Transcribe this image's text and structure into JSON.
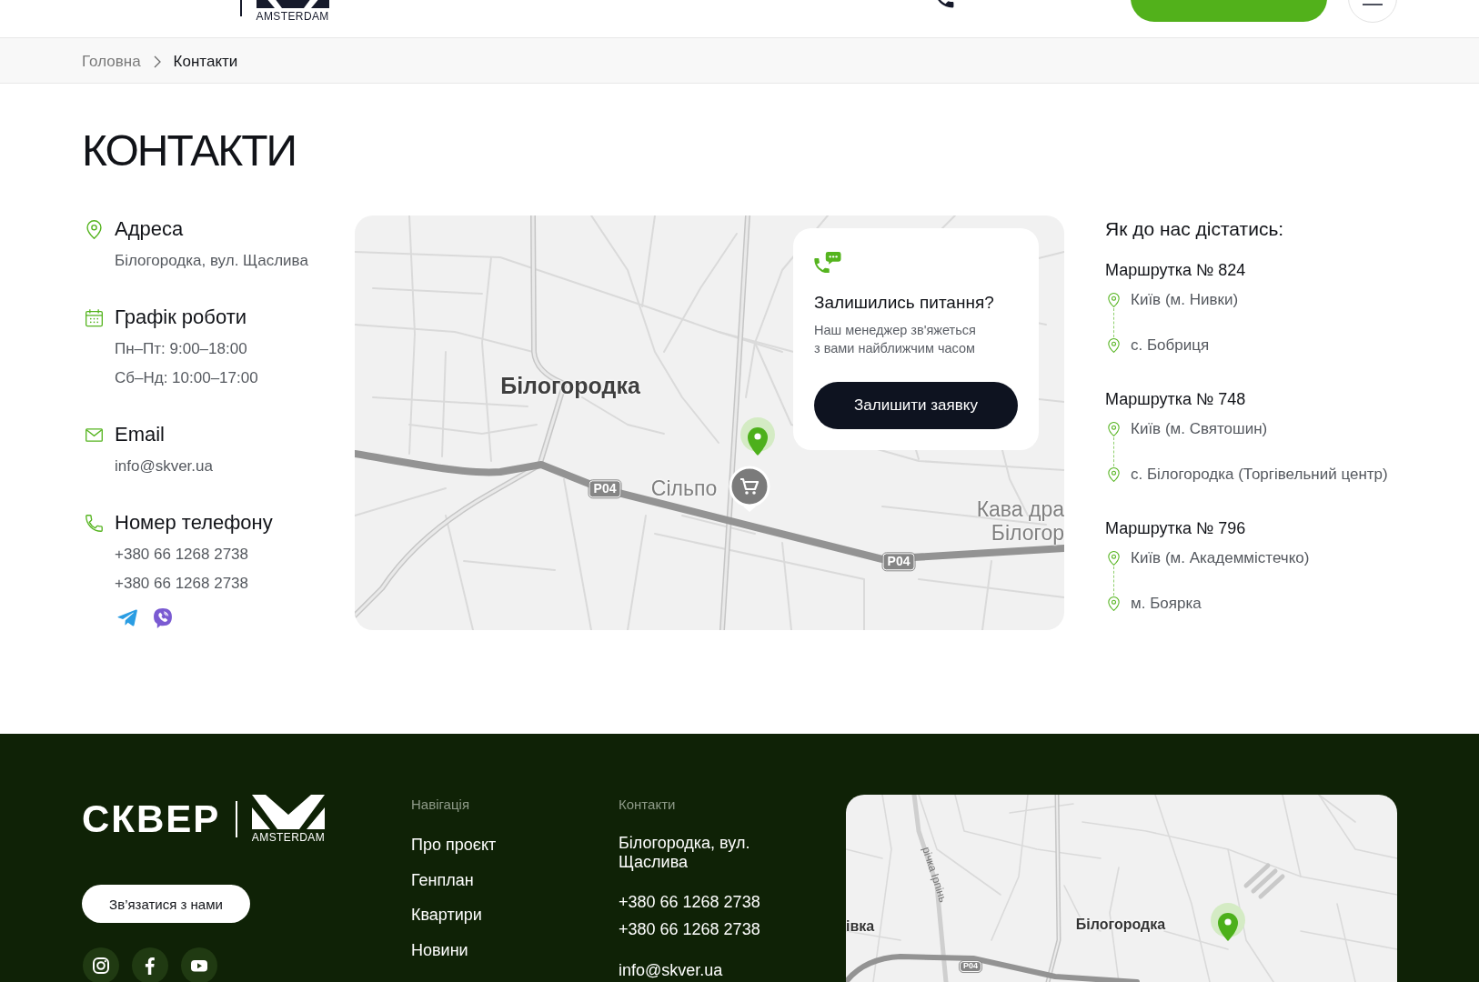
{
  "header": {
    "logo": {
      "tagline": "AMSTERDAM"
    }
  },
  "breadcrumbs": [
    {
      "label": "Головна",
      "current": false
    },
    {
      "label": "Контакти",
      "current": true
    }
  ],
  "title": "КОНТАКТИ",
  "contacts": [
    {
      "kind": "address",
      "title": "Адреса",
      "values": [
        "Білогородка, вул. Щаслива"
      ]
    },
    {
      "kind": "schedule",
      "title": "Графік роботи",
      "values": [
        "Пн–Пт: 9:00–18:00",
        "Сб–Нд: 10:00–17:00"
      ]
    },
    {
      "kind": "email",
      "title": "Email",
      "values": [
        "info@skver.ua"
      ]
    },
    {
      "kind": "phone",
      "title": "Номер телефону",
      "values": [
        "+380 66 1268 2738",
        "+380 66 1268 2738"
      ]
    }
  ],
  "map": {
    "card": {
      "title": "Залишились питання?",
      "text": "Наш менеджер зв'яжеться\nз вами найближчим часом",
      "button": "Залишити заявку"
    },
    "labels": [
      {
        "kind": "town",
        "text": "Білогородка"
      },
      {
        "kind": "road",
        "text": "P04"
      },
      {
        "kind": "poi",
        "text": "Сільпо"
      },
      {
        "kind": "poi",
        "text": "Кава дра"
      },
      {
        "kind": "poi",
        "text": "Білогор"
      },
      {
        "kind": "road",
        "text": "P04"
      }
    ]
  },
  "directions": {
    "title": "Як до нас дістатись:",
    "routes": [
      {
        "name": "Маршрутка № 824",
        "stops": [
          "Київ (м. Нивки)",
          "с. Бобриця"
        ]
      },
      {
        "name": "Маршрутка № 748",
        "stops": [
          "Київ (м. Святошин)",
          "с. Білогородка (Торгівельний центр)"
        ]
      },
      {
        "name": "Маршрутка № 796",
        "stops": [
          "Київ (м. Академмістечко)",
          "м. Боярка"
        ]
      }
    ]
  },
  "footer": {
    "logo": {
      "wordmark": "СКВЕР",
      "tagline": "AMSTERDAM"
    },
    "contact_button": "Зв’язатися з нами",
    "nav": {
      "title": "Навігація",
      "items": [
        "Про проєкт",
        "Генплан",
        "Квартири",
        "Новини"
      ]
    },
    "contacts": {
      "title": "Контакти",
      "address": "Білогородка, вул. Щаслива",
      "phones": [
        "+380 66 1268 2738",
        "+380 66 1268 2738"
      ],
      "email": "info@skver.ua"
    },
    "map": {
      "labels": [
        {
          "kind": "river",
          "text": "річка Ірпінь"
        },
        {
          "kind": "town",
          "text": "івка"
        },
        {
          "kind": "town",
          "text": "Білогородка"
        },
        {
          "kind": "road",
          "text": "P04"
        }
      ]
    }
  }
}
